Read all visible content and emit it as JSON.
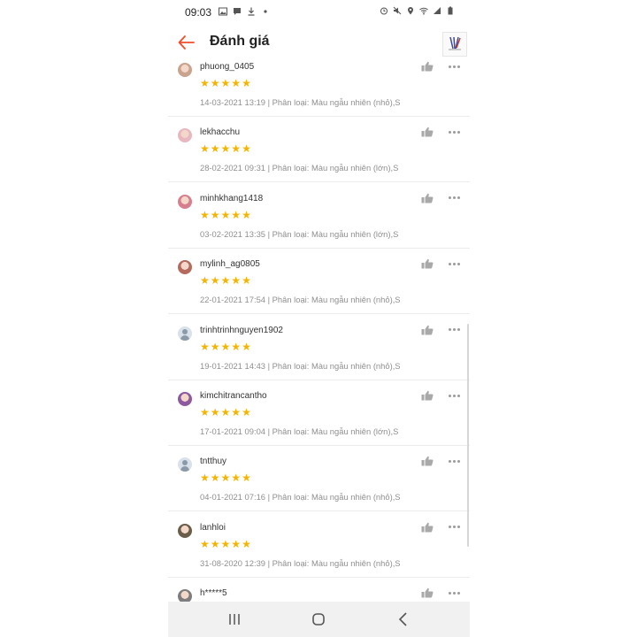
{
  "status_bar": {
    "time": "09:03"
  },
  "header": {
    "title": "Đánh giá"
  },
  "reviews": [
    {
      "username": "phuong_0405",
      "meta": "14-03-2021 13:19 | Phân loại: Màu ngẫu nhiên (nhỏ),S",
      "rating": 5,
      "avatar": "photo"
    },
    {
      "username": "lekhacchu",
      "meta": "28-02-2021 09:31 | Phân loại: Màu ngẫu nhiên (lớn),S",
      "rating": 5,
      "avatar": "photo"
    },
    {
      "username": "minhkhang1418",
      "meta": "03-02-2021 13:35 | Phân loại: Màu ngẫu nhiên (lớn),S",
      "rating": 5,
      "avatar": "photo"
    },
    {
      "username": "mylinh_ag0805",
      "meta": "22-01-2021 17:54 | Phân loại: Màu ngẫu nhiên (nhỏ),S",
      "rating": 5,
      "avatar": "photo"
    },
    {
      "username": "trinhtrinhnguyen1902",
      "meta": "19-01-2021 14:43 | Phân loại: Màu ngẫu nhiên (nhỏ),S",
      "rating": 5,
      "avatar": "default"
    },
    {
      "username": "kimchitrancantho",
      "meta": "17-01-2021 09:04 | Phân loại: Màu ngẫu nhiên (lớn),S",
      "rating": 5,
      "avatar": "photo"
    },
    {
      "username": "tntthuy",
      "meta": "04-01-2021 07:16 | Phân loại: Màu ngẫu nhiên (nhỏ),S",
      "rating": 5,
      "avatar": "default"
    },
    {
      "username": "lanhloi",
      "meta": "31-08-2020 12:39 | Phân loại: Màu ngẫu nhiên (nhỏ),S",
      "rating": 5,
      "avatar": "photo"
    },
    {
      "username": "h*****5",
      "meta": "",
      "rating": 0,
      "avatar": "photo"
    }
  ],
  "colors": {
    "accent": "#ee4d2d",
    "star": "#f5b400",
    "meta_text": "#8f8f8f"
  },
  "icons": {
    "back": "arrow-left-icon",
    "like": "thumbs-up-icon",
    "more": "more-horizontal-icon",
    "nav_recent": "recent-apps-icon",
    "nav_home": "home-icon",
    "nav_back": "nav-back-icon"
  }
}
